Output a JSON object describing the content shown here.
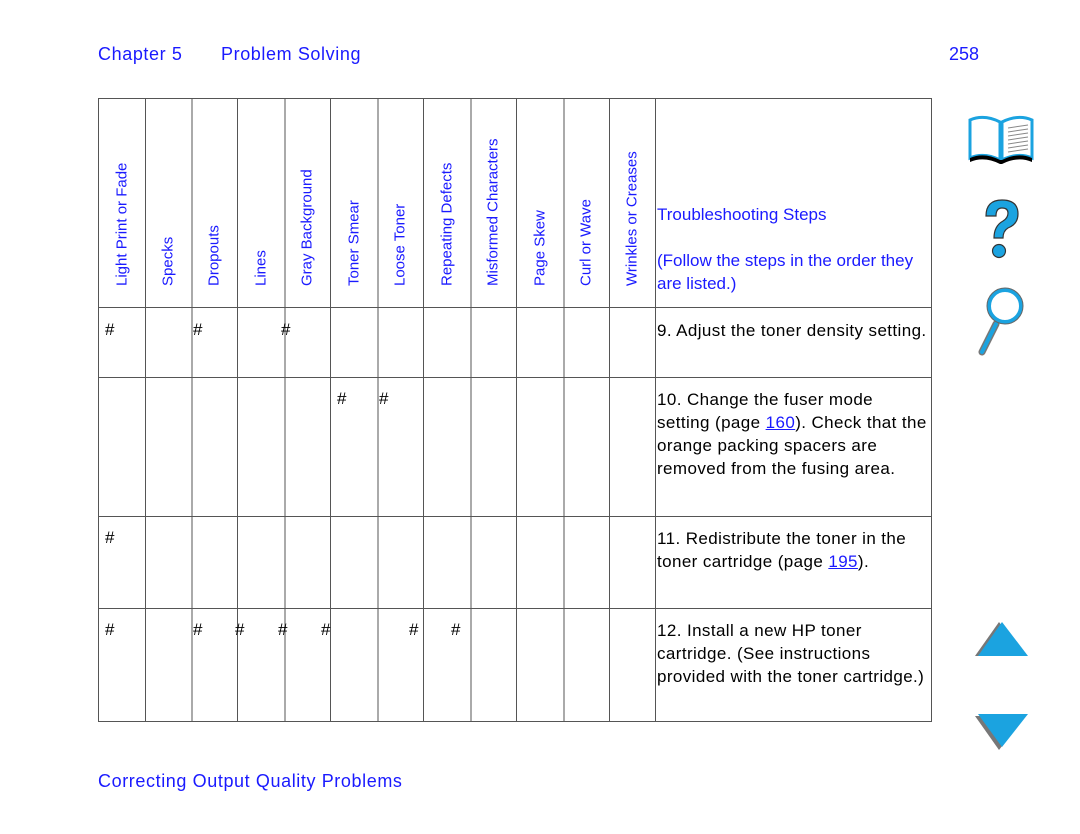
{
  "header": {
    "chapter": "Chapter 5",
    "section": "Problem Solving",
    "page_number": "258"
  },
  "table": {
    "columns": [
      "Light Print or Fade",
      "Specks",
      "Dropouts",
      "Lines",
      "Gray Background",
      "Toner Smear",
      "Loose Toner",
      "Repeating Defects",
      "Misformed Characters",
      "Page Skew",
      "Curl or Wave",
      "Wrinkles or Creases"
    ],
    "steps_header": {
      "title": "Troubleshooting Steps",
      "note": "(Follow the steps in the order they are listed.)"
    },
    "mark_symbol": "#",
    "rows": [
      {
        "marks": [
          "Light Print or Fade",
          "Dropouts",
          "Gray Background"
        ],
        "step_prefix": "9. Adjust the toner density setting.",
        "link": "",
        "step_suffix": ""
      },
      {
        "marks": [
          "Toner Smear",
          "Loose Toner"
        ],
        "step_prefix": "10. Change the fuser mode setting (page ",
        "link": "160",
        "step_suffix": "). Check that the orange packing spacers are removed from the fusing area."
      },
      {
        "marks": [
          "Light Print or Fade"
        ],
        "step_prefix": "11. Redistribute the toner in the toner cartridge (page ",
        "link": "195",
        "step_suffix": ")."
      },
      {
        "marks": [
          "Light Print or Fade",
          "Dropouts",
          "Lines",
          "Gray Background",
          "Toner Smear",
          "Loose Toner",
          "Repeating Defects"
        ],
        "step_prefix": "12. Install a new HP toner cartridge. (See instructions provided with the toner cartridge.)",
        "link": "",
        "step_suffix": ""
      }
    ]
  },
  "footer": {
    "title": "Correcting Output Quality Problems"
  },
  "nav_icons": {
    "contents": "book-icon",
    "help": "question-mark-icon",
    "search": "magnifier-icon",
    "previous": "up-arrow-icon",
    "next": "down-arrow-icon"
  },
  "colors": {
    "heading_blue": "#1a1aff",
    "icon_cyan": "#1ba3e0"
  }
}
